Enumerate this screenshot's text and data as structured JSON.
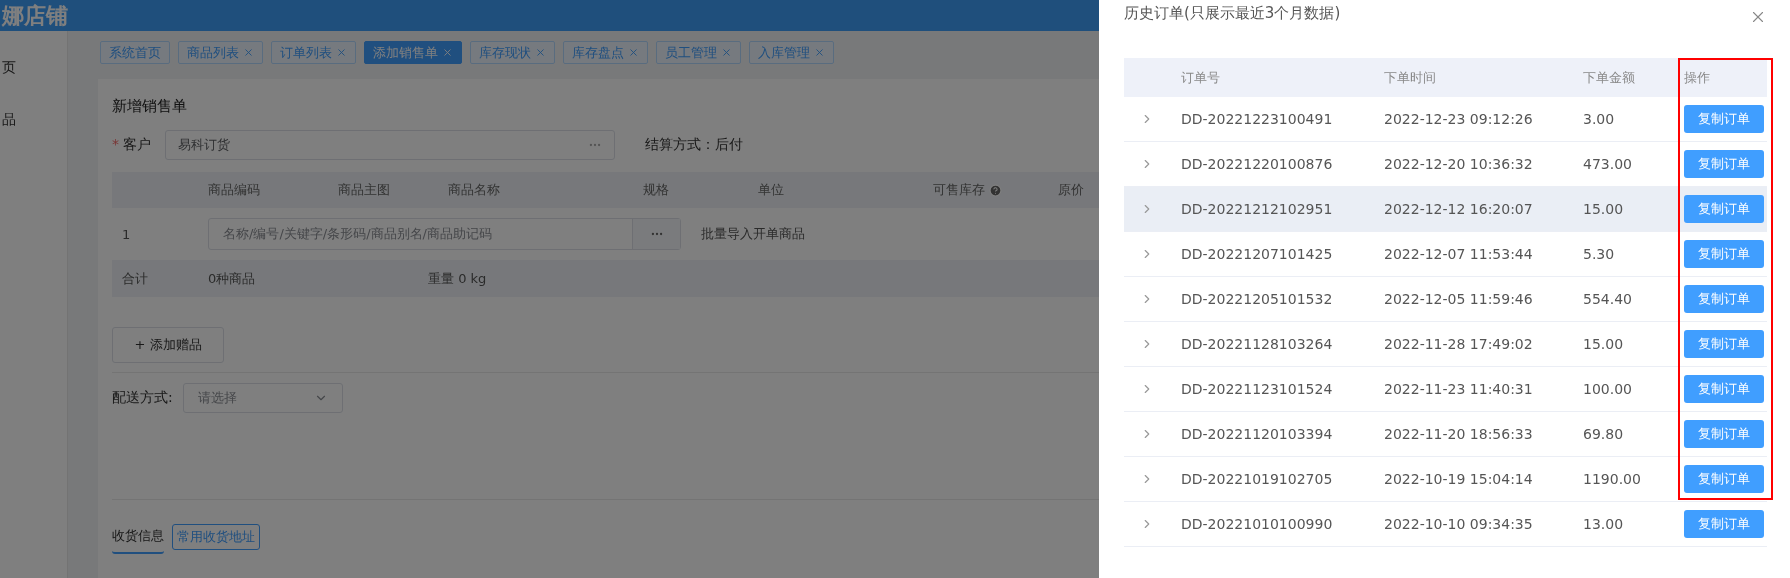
{
  "app": {
    "logo": "娜店铺",
    "sidebar": {
      "items": [
        {
          "label": "页",
          "selected": false
        },
        {
          "label": "品",
          "selected": false
        }
      ]
    },
    "tabs": [
      {
        "label": "系统首页",
        "selected": false,
        "closable": false
      },
      {
        "label": "商品列表",
        "selected": false,
        "closable": true
      },
      {
        "label": "订单列表",
        "selected": false,
        "closable": true
      },
      {
        "label": "添加销售单",
        "selected": true,
        "closable": true
      },
      {
        "label": "库存现状",
        "selected": false,
        "closable": true
      },
      {
        "label": "库存盘点",
        "selected": false,
        "closable": true
      },
      {
        "label": "员工管理",
        "selected": false,
        "closable": true
      },
      {
        "label": "入库管理",
        "selected": false,
        "closable": true
      }
    ],
    "form": {
      "title": "新增销售单",
      "required_mark": "*",
      "customer_label": "客户",
      "customer_value": "易科订货",
      "settlement_label": "结算方式：",
      "settlement_value": "后付",
      "columns": [
        "商品编码",
        "商品主图",
        "商品名称",
        "规格",
        "单位",
        "可售库存",
        "原价"
      ],
      "row": {
        "index": "1",
        "search_placeholder": "名称/编号/关键字/条形码/商品别名/商品助记码",
        "batch_import": "批量导入开单商品"
      },
      "total": {
        "label": "合计",
        "count": "0种商品",
        "weight": "重量 0 kg"
      },
      "add_gift": "+ 添加赠品",
      "delivery_label": "配送方式:",
      "delivery_placeholder": "请选择",
      "bottom_tabs": [
        {
          "label": "收货信息",
          "kind": "tab",
          "selected": true
        },
        {
          "label": "常用收货地址",
          "kind": "button",
          "selected": false
        }
      ]
    }
  },
  "drawer": {
    "title": "历史订单(只展示最近3个月数据)",
    "columns": [
      "订单号",
      "下单时间",
      "下单金额",
      "操作"
    ],
    "rows": [
      {
        "order_no": "DD-20221223100491",
        "time": "2022-12-23 09:12:26",
        "amount": "3.00",
        "action": "复制订单",
        "striped": false
      },
      {
        "order_no": "DD-20221220100876",
        "time": "2022-12-20 10:36:32",
        "amount": "473.00",
        "action": "复制订单",
        "striped": false
      },
      {
        "order_no": "DD-20221212102951",
        "time": "2022-12-12 16:20:07",
        "amount": "15.00",
        "action": "复制订单",
        "striped": true
      },
      {
        "order_no": "DD-20221207101425",
        "time": "2022-12-07 11:53:44",
        "amount": "5.30",
        "action": "复制订单",
        "striped": false
      },
      {
        "order_no": "DD-20221205101532",
        "time": "2022-12-05 11:59:46",
        "amount": "554.40",
        "action": "复制订单",
        "striped": false
      },
      {
        "order_no": "DD-20221128103264",
        "time": "2022-11-28 17:49:02",
        "amount": "15.00",
        "action": "复制订单",
        "striped": false
      },
      {
        "order_no": "DD-20221123101524",
        "time": "2022-11-23 11:40:31",
        "amount": "100.00",
        "action": "复制订单",
        "striped": false
      },
      {
        "order_no": "DD-20221120103394",
        "time": "2022-11-20 18:56:33",
        "amount": "69.80",
        "action": "复制订单",
        "striped": false
      },
      {
        "order_no": "DD-20221019102705",
        "time": "2022-10-19 15:04:14",
        "amount": "1190.00",
        "action": "复制订单",
        "striped": false
      },
      {
        "order_no": "DD-20221010100990",
        "time": "2022-10-10 09:34:35",
        "amount": "13.00",
        "action": "复制订单",
        "striped": false
      }
    ]
  }
}
